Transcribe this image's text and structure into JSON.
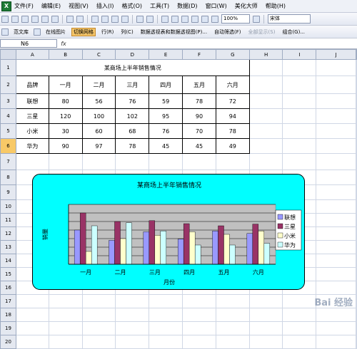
{
  "menubar": {
    "items": [
      "文件(F)",
      "编辑(E)",
      "视图(V)",
      "插入(I)",
      "格式(O)",
      "工具(T)",
      "数据(D)",
      "窗口(W)",
      "美化大师",
      "帮助(H)"
    ]
  },
  "toolbar": {
    "zoom": "100%",
    "font": "宋体"
  },
  "toolbar2": {
    "items": [
      "范文库",
      "在线图片",
      "切换网格",
      "行(R)",
      "列(C)",
      "数据透视表和数据透视图(P)...",
      "自动筛选(F)",
      "全部显示(S)",
      "组合(G)..."
    ]
  },
  "formula_bar": {
    "name_box": "N6",
    "fx": "fx",
    "value": ""
  },
  "sheet": {
    "columns": [
      "A",
      "B",
      "C",
      "D",
      "E",
      "F",
      "G",
      "H",
      "I",
      "J"
    ],
    "rows": [
      "1",
      "2",
      "3",
      "4",
      "5",
      "6",
      "7",
      "8",
      "9",
      "10",
      "11",
      "12",
      "13",
      "14",
      "15",
      "16",
      "17",
      "18",
      "19",
      "20"
    ],
    "title": "某商场上半年销售情况",
    "header": [
      "品牌",
      "一月",
      "二月",
      "三月",
      "四月",
      "五月",
      "六月"
    ],
    "data": [
      [
        "联想",
        "80",
        "56",
        "76",
        "59",
        "78",
        "72"
      ],
      [
        "三星",
        "120",
        "100",
        "102",
        "95",
        "90",
        "94"
      ],
      [
        "小米",
        "30",
        "60",
        "68",
        "76",
        "70",
        "78"
      ],
      [
        "华为",
        "90",
        "97",
        "78",
        "45",
        "45",
        "49"
      ]
    ]
  },
  "chart_data": {
    "type": "bar",
    "title": "某商场上半年销售情况",
    "xlabel": "月份",
    "ylabel": "销量",
    "categories": [
      "一月",
      "二月",
      "三月",
      "四月",
      "五月",
      "六月"
    ],
    "series": [
      {
        "name": "联想",
        "values": [
          80,
          56,
          76,
          59,
          78,
          72
        ],
        "color": "#9999ff"
      },
      {
        "name": "三星",
        "values": [
          120,
          100,
          102,
          95,
          90,
          94
        ],
        "color": "#993366"
      },
      {
        "name": "小米",
        "values": [
          30,
          60,
          68,
          76,
          70,
          78
        ],
        "color": "#ffffcc"
      },
      {
        "name": "华为",
        "values": [
          90,
          97,
          78,
          45,
          45,
          49
        ],
        "color": "#ccffff"
      }
    ],
    "ylim": [
      0,
      140
    ],
    "legend": "right",
    "grid": true
  },
  "watermark": "Bai 经验"
}
